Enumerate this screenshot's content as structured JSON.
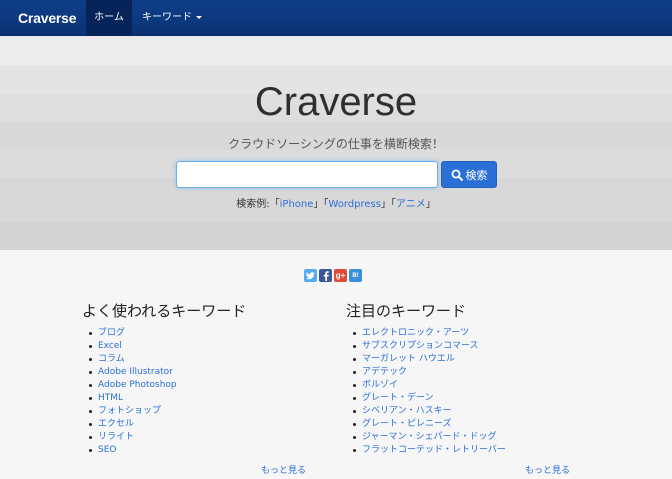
{
  "navbar": {
    "brand": "Craverse",
    "home_label": "ホーム",
    "keyword_label": "キーワード"
  },
  "hero": {
    "title": "Craverse",
    "subtitle": "クラウドソーシングの仕事を横断検索！",
    "search": {
      "value": "",
      "placeholder": ""
    },
    "search_button_label": "検索",
    "examples": {
      "prefix": "検索例:",
      "items": [
        "iPhone",
        "Wordpress",
        "アニメ"
      ]
    }
  },
  "social": {
    "icons": [
      "twitter-icon",
      "facebook-icon",
      "google-plus-icon",
      "hatena-bookmark-icon"
    ],
    "colors": {
      "twitter": "#55acee",
      "facebook": "#3b5998",
      "google_plus": "#dd4b39",
      "hatena": "#3a8fd9"
    }
  },
  "popular": {
    "heading": "よく使われるキーワード",
    "items": [
      "ブログ",
      "Excel",
      "コラム",
      "Adobe Illustrator",
      "Adobe Photoshop",
      "HTML",
      "フォトショップ",
      "エクセル",
      "リライト",
      "SEO"
    ],
    "more_label": "もっと見る"
  },
  "featured": {
    "heading": "注目のキーワード",
    "items": [
      "エレクトロニック・アーツ",
      "サブスクリプションコマース",
      "マーガレット ハウエル",
      "アデテック",
      "ボルゾイ",
      "グレート・デーン",
      "シベリアン・ハスキー",
      "グレート・ピレニーズ",
      "ジャーマン・シェパード・ドッグ",
      "フラットコーテッド・レトリーバー"
    ],
    "more_label": "もっと見る"
  },
  "colors": {
    "navbar": "#0f3f8a",
    "link": "#2a6fd6",
    "button": "#2a6fd6"
  }
}
